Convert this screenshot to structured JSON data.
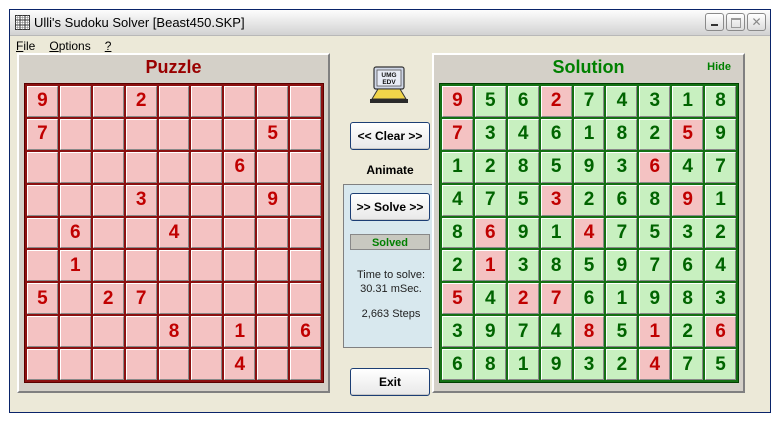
{
  "window": {
    "title": "Ulli's Sudoku Solver [Beast450.SKP]"
  },
  "menu": [
    {
      "label_u": "F",
      "label_rest": "ile"
    },
    {
      "label_u": "O",
      "label_rest": "ptions"
    },
    {
      "label_u": "?",
      "label_rest": ""
    }
  ],
  "puzzle": {
    "title": "Puzzle",
    "rows": [
      [
        "9",
        "",
        "",
        "2",
        "",
        "",
        "",
        "",
        ""
      ],
      [
        "7",
        "",
        "",
        "",
        "",
        "",
        "",
        "5",
        ""
      ],
      [
        "",
        "",
        "",
        "",
        "",
        "",
        "6",
        "",
        ""
      ],
      [
        "",
        "",
        "",
        "3",
        "",
        "",
        "",
        "9",
        ""
      ],
      [
        "",
        "6",
        "",
        "",
        "4",
        "",
        "",
        "",
        ""
      ],
      [
        "",
        "1",
        "",
        "",
        "",
        "",
        "",
        "",
        ""
      ],
      [
        "5",
        "",
        "2",
        "7",
        "",
        "",
        "",
        "",
        ""
      ],
      [
        "",
        "",
        "",
        "",
        "8",
        "",
        "1",
        "",
        "6"
      ],
      [
        "",
        "",
        "",
        "",
        "",
        "",
        "4",
        "",
        ""
      ]
    ]
  },
  "solution": {
    "title": "Solution",
    "hide_label": "Hide",
    "rows": [
      [
        "9",
        "5",
        "6",
        "2",
        "7",
        "4",
        "3",
        "1",
        "8"
      ],
      [
        "7",
        "3",
        "4",
        "6",
        "1",
        "8",
        "2",
        "5",
        "9"
      ],
      [
        "1",
        "2",
        "8",
        "5",
        "9",
        "3",
        "6",
        "4",
        "7"
      ],
      [
        "4",
        "7",
        "5",
        "3",
        "2",
        "6",
        "8",
        "9",
        "1"
      ],
      [
        "8",
        "6",
        "9",
        "1",
        "4",
        "7",
        "5",
        "3",
        "2"
      ],
      [
        "2",
        "1",
        "3",
        "8",
        "5",
        "9",
        "7",
        "6",
        "4"
      ],
      [
        "5",
        "4",
        "2",
        "7",
        "6",
        "1",
        "9",
        "8",
        "3"
      ],
      [
        "3",
        "9",
        "7",
        "4",
        "8",
        "5",
        "1",
        "2",
        "6"
      ],
      [
        "6",
        "8",
        "1",
        "9",
        "3",
        "2",
        "4",
        "7",
        "5"
      ]
    ]
  },
  "controls": {
    "logo_text": "UMG EDV",
    "clear_label": "<< Clear >>",
    "animate_label": "Animate",
    "solve_label": ">> Solve >>",
    "status": "Solved",
    "time_label": "Time to solve:",
    "time_value": "30.31 mSec.",
    "steps": "2,663 Steps",
    "exit_label": "Exit"
  },
  "colors": {
    "puzzle_accent": "#990000",
    "solution_accent": "#008000",
    "given_cell": "#f4c2c2",
    "solved_cell": "#c8f0c0"
  }
}
